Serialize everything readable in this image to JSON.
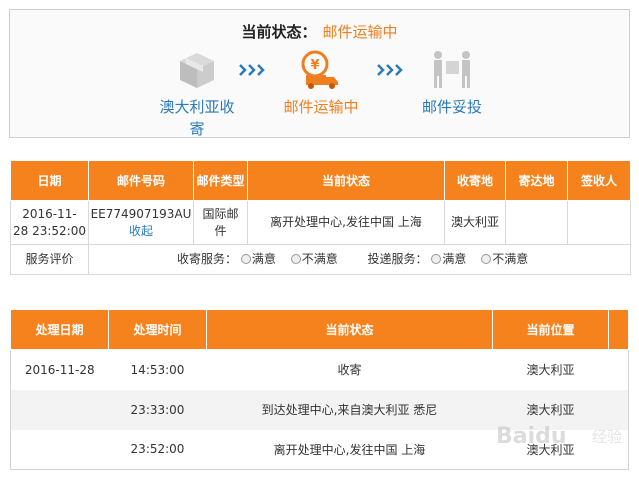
{
  "status": {
    "label": "当前状态：",
    "value": "邮件运输中",
    "steps": [
      {
        "line1": "澳大利亚收",
        "line2": "寄",
        "icon": "box-icon"
      },
      {
        "line1": "邮件运输中",
        "line2": "",
        "icon": "delivery-truck-icon"
      },
      {
        "line1": "邮件妥投",
        "line2": "",
        "icon": "handover-icon"
      }
    ]
  },
  "mail_table": {
    "headers": [
      "日期",
      "邮件号码",
      "邮件类型",
      "当前状态",
      "收寄地",
      "寄达地",
      "签收人"
    ],
    "row": {
      "date_line1": "2016-11-",
      "date_line2": "28 23:52:00",
      "mail_number": "EE774907193AU",
      "collapse_link": "收起",
      "type_line1": "国际邮",
      "type_line2": "件",
      "status": "离开处理中心,发往中国 上海",
      "origin": "澳大利亚",
      "destination": "",
      "signer": ""
    },
    "rating": {
      "label": "服务评价",
      "collect_label": "收寄服务：",
      "deliver_label": "投递服务：",
      "satisfied": "满意",
      "unsatisfied": "不满意"
    }
  },
  "tracking_table": {
    "headers": [
      "处理日期",
      "处理时间",
      "当前状态",
      "当前位置"
    ],
    "rows": [
      {
        "date": "2016-11-28",
        "time": "14:53:00",
        "status": "收寄",
        "location": "澳大利亚"
      },
      {
        "date": "",
        "time": "23:33:00",
        "status": "到达处理中心,来自澳大利亚 悉尼",
        "location": "澳大利亚"
      },
      {
        "date": "",
        "time": "23:52:00",
        "status": "离开处理中心,发往中国 上海",
        "location": "澳大利亚"
      }
    ]
  },
  "watermark": {
    "text": "Baidu",
    "sub": "经验"
  },
  "colors": {
    "accent": "#f6821e",
    "link": "#2a7ab8",
    "status_orange": "#f07e1e"
  }
}
